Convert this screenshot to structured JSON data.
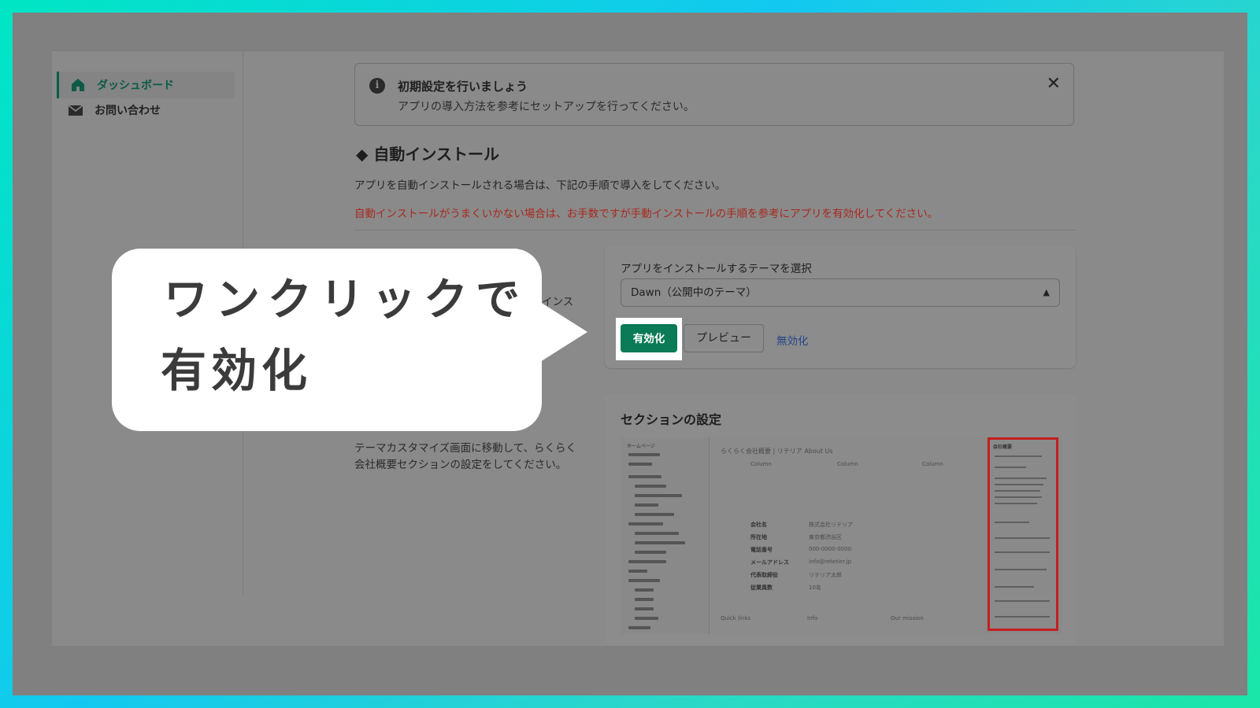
{
  "sidebar": {
    "items": [
      {
        "label": "ダッシュボード",
        "icon": "home-icon",
        "active": true
      },
      {
        "label": "お問い合わせ",
        "icon": "mail-icon",
        "active": false
      }
    ]
  },
  "banner": {
    "title": "初期設定を行いましょう",
    "description": "アプリの導入方法を参考にセットアップを行ってください。",
    "close_label": "✕"
  },
  "auto_install": {
    "title": "◆ 自動インストール",
    "instruction": "アプリを自動インストールされる場合は、下記の手順で導入をしてください。",
    "warning": "自動インストールがうまくいかない場合は、お手数ですが手動インストールの手順を参考にアプリを有効化してください。",
    "partial_left_text": "インス"
  },
  "theme_card": {
    "label": "アプリをインストールするテーマを選択",
    "selected_theme": "Dawn（公開中のテーマ）",
    "activate_label": "有効化",
    "preview_label": "プレビュー",
    "disable_label": "無効化"
  },
  "section_settings": {
    "title": "セクションの設定",
    "description": "テーマカスタマイズ画面に移動して、らくらく会社概要セクションの設定をしてください。"
  },
  "thumbnail": {
    "header_text": "らくらく会社概要 | リテリア About Us",
    "columns": [
      "Column",
      "Column",
      "Column"
    ],
    "rows": [
      {
        "k": "会社名",
        "v": "株式会社リテリア"
      },
      {
        "k": "所在地",
        "v": "東京都渋谷区"
      },
      {
        "k": "電話番号",
        "v": "000-0000-0000"
      },
      {
        "k": "メールアドレス",
        "v": "info@retetier.jp"
      },
      {
        "k": "代表取締役",
        "v": "リテリア太郎"
      },
      {
        "k": "従業員数",
        "v": "10名"
      }
    ],
    "footer": [
      "Quick links",
      "Info",
      "Our mission"
    ],
    "sidebar_top": "ホームページ",
    "right_panel_title": "会社概要"
  },
  "callout": {
    "line1": "ワンクリックで",
    "line2": "有効化"
  },
  "colors": {
    "accent_green": "#0b7a56",
    "warning_red": "#a8291e",
    "highlight_red": "#c31f1f"
  }
}
